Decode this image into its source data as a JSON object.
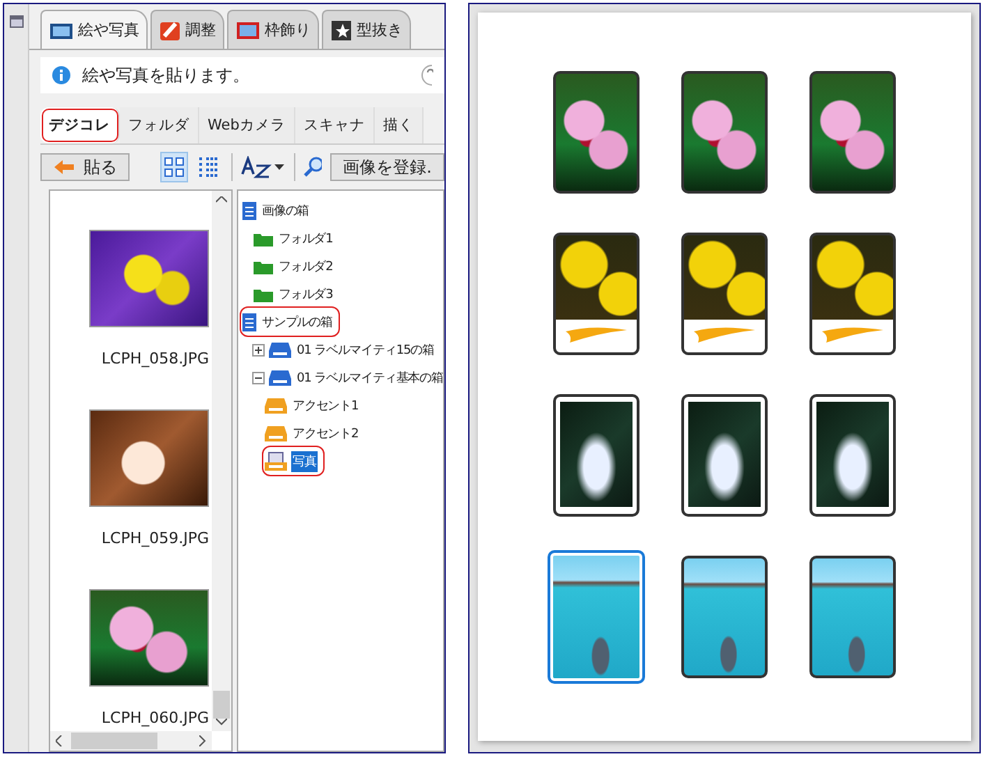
{
  "tabs": [
    {
      "label": "絵や写真",
      "kind": "photo",
      "selected": true
    },
    {
      "label": "調整",
      "kind": "brush",
      "selected": false
    },
    {
      "label": "枠飾り",
      "kind": "frame",
      "selected": false
    },
    {
      "label": "型抜き",
      "kind": "star",
      "selected": false
    }
  ],
  "info": {
    "text": "絵や写真を貼ります。"
  },
  "subtabs": [
    {
      "label": "デジコレ",
      "selected": true,
      "highlighted": true
    },
    {
      "label": "フォルダ",
      "selected": false,
      "highlighted": false
    },
    {
      "label": "Webカメラ",
      "selected": false,
      "highlighted": false
    },
    {
      "label": "スキャナ",
      "selected": false,
      "highlighted": false
    },
    {
      "label": "描く",
      "selected": false,
      "highlighted": false
    }
  ],
  "toolbar": {
    "paste_button": "貼る",
    "view_modes": [
      {
        "kind": "grid",
        "selected": true
      },
      {
        "kind": "list",
        "selected": false
      }
    ],
    "register_button": "画像を登録."
  },
  "thumbnails": [
    {
      "caption": "LCPH_058.JPG",
      "kind": "daisy"
    },
    {
      "caption": "LCPH_059.JPG",
      "kind": "white-orchid"
    },
    {
      "caption": "LCPH_060.JPG",
      "kind": "orchid"
    }
  ],
  "tree": [
    {
      "label": "画像の箱",
      "kind": "box",
      "selected": false,
      "highlighted": false,
      "children": [
        {
          "label": "フォルダ1",
          "kind": "folder",
          "selected": false,
          "highlighted": false
        },
        {
          "label": "フォルダ2",
          "kind": "folder",
          "selected": false,
          "highlighted": false
        },
        {
          "label": "フォルダ3",
          "kind": "folder",
          "selected": false,
          "highlighted": false
        }
      ]
    },
    {
      "label": "サンプルの箱",
      "kind": "box",
      "selected": false,
      "highlighted": true,
      "children": [
        {
          "label": "01 ラベルマイティ15の箱",
          "kind": "drive",
          "selected": false,
          "highlighted": false,
          "expanded": false
        },
        {
          "label": "01 ラベルマイティ基本の箱",
          "kind": "drive",
          "selected": false,
          "highlighted": false,
          "expanded": true,
          "children": [
            {
              "label": "アクセント1",
              "kind": "tray",
              "selected": false,
              "highlighted": false
            },
            {
              "label": "アクセント2",
              "kind": "tray",
              "selected": false,
              "highlighted": false
            },
            {
              "label": "写真",
              "kind": "tray-open",
              "selected": true,
              "highlighted": true
            }
          ]
        }
      ]
    }
  ],
  "labels": [
    {
      "kind": "orchid",
      "selected": false
    },
    {
      "kind": "orchid",
      "selected": false
    },
    {
      "kind": "orchid",
      "selected": false
    },
    {
      "kind": "daisy-banner",
      "selected": false
    },
    {
      "kind": "daisy-banner",
      "selected": false
    },
    {
      "kind": "daisy-banner",
      "selected": false
    },
    {
      "kind": "waterfall",
      "selected": false
    },
    {
      "kind": "waterfall",
      "selected": false
    },
    {
      "kind": "waterfall",
      "selected": false
    },
    {
      "kind": "dolphin",
      "selected": true
    },
    {
      "kind": "dolphin",
      "selected": false
    },
    {
      "kind": "dolphin",
      "selected": false
    }
  ]
}
